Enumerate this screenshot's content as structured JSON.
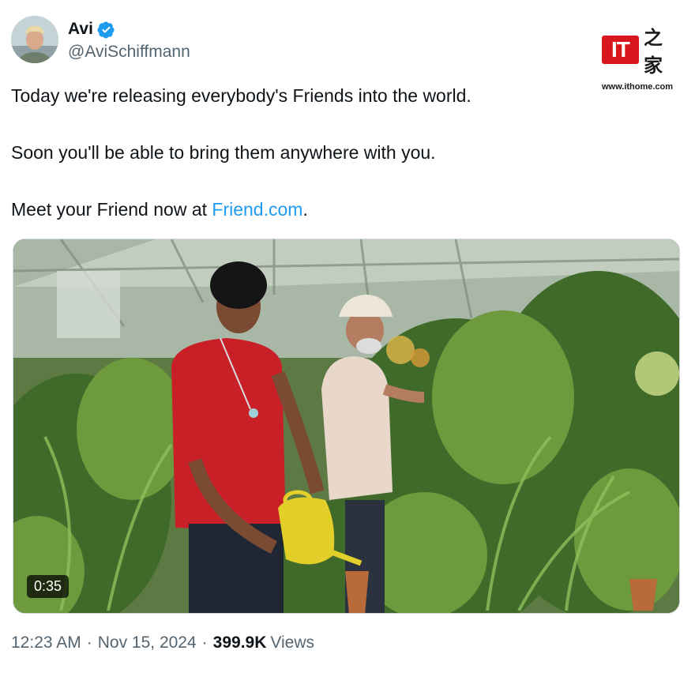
{
  "author": {
    "display_name": "Avi",
    "handle": "@AviSchiffmann",
    "verified": true,
    "verified_icon": "verified-badge-icon",
    "accent_color": "#1d9bf0"
  },
  "watermark": {
    "logo_text": "IT",
    "logo_chars": "之家",
    "url": "www.ithome.com",
    "brand_color": "#d7171c"
  },
  "tweet": {
    "line1": "Today we're releasing everybody's Friends into the world.",
    "line2": "Soon you'll be able to bring them anywhere with you.",
    "line3_prefix": "Meet your Friend now at ",
    "line3_link": "Friend.com",
    "line3_suffix": "."
  },
  "media": {
    "duration": "0:35"
  },
  "meta": {
    "time": "12:23 AM",
    "separator": "·",
    "date": "Nov 15, 2024",
    "views_count": "399.9K",
    "views_label": "Views"
  }
}
